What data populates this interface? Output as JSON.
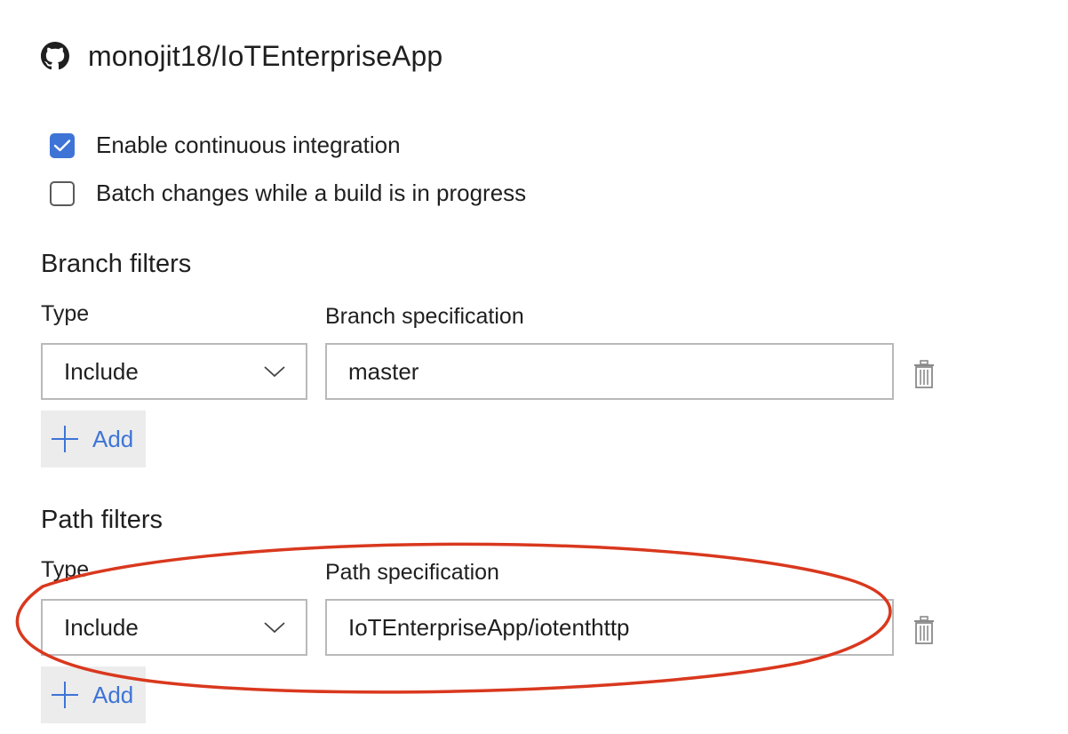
{
  "repo": {
    "icon": "github-icon",
    "name": "monojit18/IoTEnterpriseApp"
  },
  "options": {
    "enable_ci": {
      "label": "Enable continuous integration",
      "checked": true
    },
    "batch_changes": {
      "label": "Batch changes while a build is in progress",
      "checked": false
    }
  },
  "branch_filters": {
    "title": "Branch filters",
    "type_label": "Type",
    "spec_label": "Branch specification",
    "rows": [
      {
        "type": "Include",
        "spec": "master"
      }
    ],
    "add_label": "Add"
  },
  "path_filters": {
    "title": "Path filters",
    "type_label": "Type",
    "spec_label": "Path specification",
    "rows": [
      {
        "type": "Include",
        "spec": "IoTEnterpriseApp/iotenthttp"
      }
    ],
    "add_label": "Add"
  },
  "colors": {
    "accent": "#3e74d6",
    "annotation": "#d9381e",
    "border": "#b9b9b9",
    "button_bg": "#ececec"
  }
}
